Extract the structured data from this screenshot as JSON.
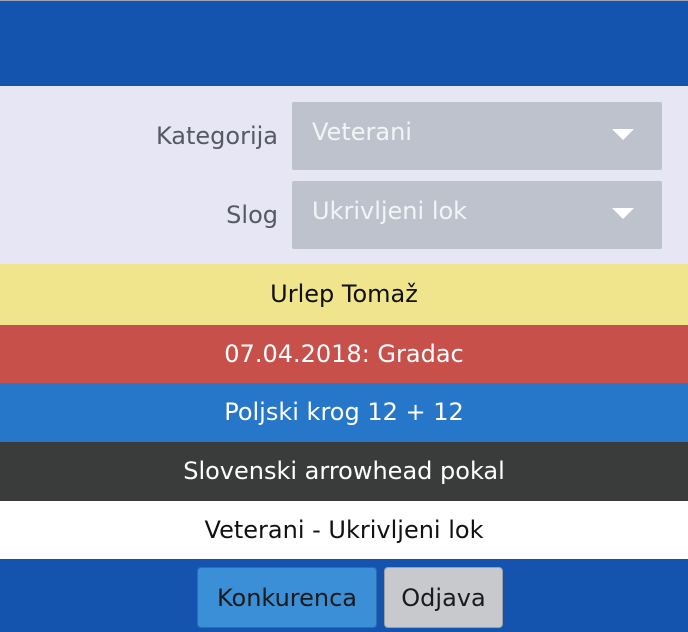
{
  "filters": {
    "category": {
      "label": "Kategorija",
      "value": "Veterani"
    },
    "style": {
      "label": "Slog",
      "value": "Ukrivljeni lok"
    }
  },
  "info": {
    "archer": "Urlep Tomaž",
    "event": "07.04.2018: Gradac",
    "round": "Poljski krog 12 + 12",
    "cup": "Slovenski arrowhead pokal",
    "category_style": "Veterani - Ukrivljeni lok"
  },
  "actions": {
    "competition_label": "Konkurenca",
    "logout_label": "Odjava"
  },
  "colors": {
    "header": "#1453ae",
    "filters_bg": "#e6e6f5",
    "select_bg": "#bdc2cc",
    "archer_band": "#f0e48c",
    "event_band": "#c8504b",
    "round_band": "#2677c9",
    "cup_band": "#393c3a",
    "primary_button": "#3b8fd6",
    "secondary_button": "#c7c9cd"
  },
  "icons": {
    "select_arrow": "chevron-down-icon"
  }
}
